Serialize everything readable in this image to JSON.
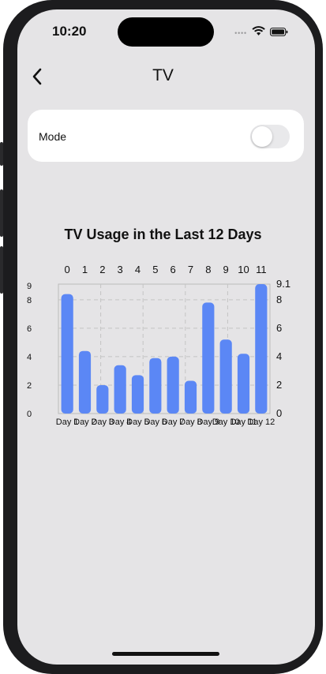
{
  "status_bar": {
    "time": "10:20",
    "icons": [
      "cellular-dots-icon",
      "wifi-icon",
      "battery-icon"
    ]
  },
  "nav": {
    "title": "TV",
    "back_icon": "chevron-left-icon"
  },
  "settings_card": {
    "mode_label": "Mode",
    "mode_toggle_on": false
  },
  "colors": {
    "bar": "#5b87f5",
    "background": "#e5e4e6",
    "card": "#ffffff"
  },
  "chart_title": "TV Usage in the Last 12 Days",
  "chart_data": {
    "type": "bar",
    "title": "TV Usage in the Last 12 Days",
    "categories": [
      "Day 1",
      "Day 2",
      "Day 3",
      "Day 4",
      "Day 5",
      "Day 6",
      "Day 7",
      "Day 8",
      "Day 9",
      "Day 10",
      "Day 11",
      "Day 12"
    ],
    "top_index_labels": [
      "0",
      "1",
      "2",
      "3",
      "4",
      "5",
      "6",
      "7",
      "8",
      "9",
      "10",
      "11"
    ],
    "values": [
      8.4,
      4.4,
      2.0,
      3.4,
      2.7,
      3.9,
      4.0,
      2.3,
      7.8,
      5.2,
      4.2,
      9.1
    ],
    "left_ticks": [
      "0",
      "2",
      "4",
      "6",
      "8",
      "9"
    ],
    "right_ticks": [
      "0",
      "2",
      "4",
      "6",
      "8",
      "9.1"
    ],
    "ylim": [
      0,
      9.1
    ],
    "grid": "dashed",
    "xlabel": "",
    "ylabel": ""
  }
}
